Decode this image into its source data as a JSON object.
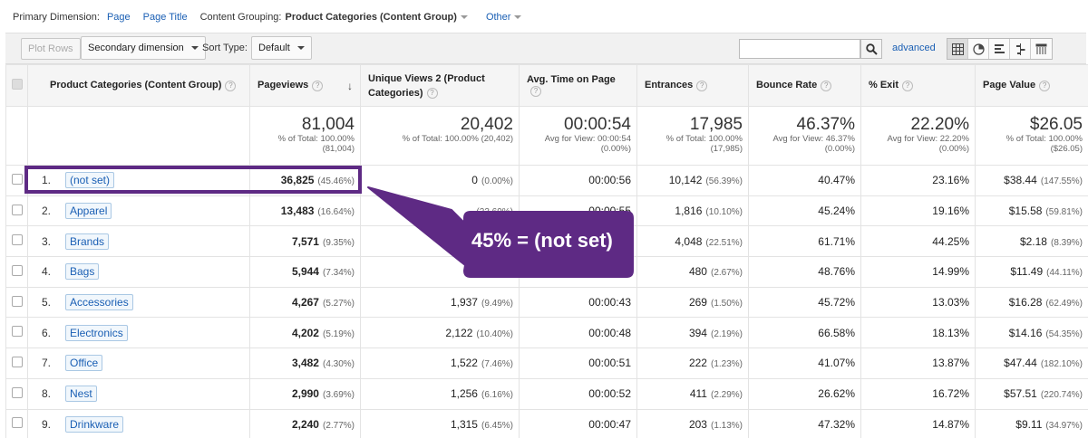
{
  "dimension_bar": {
    "label": "Primary Dimension:",
    "options": [
      "Page",
      "Page Title"
    ],
    "grouping_label": "Content Grouping:",
    "grouping_value": "Product Categories (Content Group)",
    "other": "Other"
  },
  "toolbar": {
    "plot_rows": "Plot Rows",
    "secondary_dimension": "Secondary dimension",
    "sort_type_label": "Sort Type:",
    "sort_type_value": "Default",
    "search_value": "",
    "advanced": "advanced"
  },
  "table": {
    "headers": {
      "dimension": "Product Categories (Content Group)",
      "pageviews": "Pageviews",
      "unique_views": "Unique Views 2 (Product Categories)",
      "avg_time": "Avg. Time on Page",
      "entrances": "Entrances",
      "bounce_rate": "Bounce Rate",
      "exit": "% Exit",
      "page_value": "Page Value"
    },
    "totals": {
      "pageviews": {
        "value": "81,004",
        "sub": "% of Total: 100.00% (81,004)"
      },
      "unique_views": {
        "value": "20,402",
        "sub": "% of Total: 100.00% (20,402)"
      },
      "avg_time": {
        "value": "00:00:54",
        "sub": "Avg for View: 00:00:54 (0.00%)"
      },
      "entrances": {
        "value": "17,985",
        "sub": "% of Total: 100.00% (17,985)"
      },
      "bounce_rate": {
        "value": "46.37%",
        "sub": "Avg for View: 46.37% (0.00%)"
      },
      "exit": {
        "value": "22.20%",
        "sub": "Avg for View: 22.20% (0.00%)"
      },
      "page_value": {
        "value": "$26.05",
        "sub": "% of Total: 100.00% ($26.05)"
      }
    },
    "rows": [
      {
        "num": "1.",
        "dim": "(not set)",
        "pv": "36,825",
        "pv_pct": "(45.46%)",
        "uv": "0",
        "uv_pct": "(0.00%)",
        "time": "00:00:56",
        "ent": "10,142",
        "ent_pct": "(56.39%)",
        "bounce": "40.47%",
        "exit": "23.16%",
        "val": "$38.44",
        "val_pct": "(147.55%)"
      },
      {
        "num": "2.",
        "dim": "Apparel",
        "pv": "13,483",
        "pv_pct": "(16.64%)",
        "uv": "",
        "uv_pct": "(23.69%)",
        "time": "00:00:55",
        "ent": "1,816",
        "ent_pct": "(10.10%)",
        "bounce": "45.24%",
        "exit": "19.16%",
        "val": "$15.58",
        "val_pct": "(59.81%)"
      },
      {
        "num": "3.",
        "dim": "Brands",
        "pv": "7,571",
        "pv_pct": "(9.35%)",
        "uv": "5,",
        "uv_pct": "",
        "time": "",
        "ent": "4,048",
        "ent_pct": "(22.51%)",
        "bounce": "61.71%",
        "exit": "44.25%",
        "val": "$2.18",
        "val_pct": "(8.39%)"
      },
      {
        "num": "4.",
        "dim": "Bags",
        "pv": "5,944",
        "pv_pct": "(7.34%)",
        "uv": "2,3",
        "uv_pct": "",
        "time": "",
        "ent": "480",
        "ent_pct": "(2.67%)",
        "bounce": "48.76%",
        "exit": "14.99%",
        "val": "$11.49",
        "val_pct": "(44.11%)"
      },
      {
        "num": "5.",
        "dim": "Accessories",
        "pv": "4,267",
        "pv_pct": "(5.27%)",
        "uv": "1,937",
        "uv_pct": "(9.49%)",
        "time": "00:00:43",
        "ent": "269",
        "ent_pct": "(1.50%)",
        "bounce": "45.72%",
        "exit": "13.03%",
        "val": "$16.28",
        "val_pct": "(62.49%)"
      },
      {
        "num": "6.",
        "dim": "Electronics",
        "pv": "4,202",
        "pv_pct": "(5.19%)",
        "uv": "2,122",
        "uv_pct": "(10.40%)",
        "time": "00:00:48",
        "ent": "394",
        "ent_pct": "(2.19%)",
        "bounce": "66.58%",
        "exit": "18.13%",
        "val": "$14.16",
        "val_pct": "(54.35%)"
      },
      {
        "num": "7.",
        "dim": "Office",
        "pv": "3,482",
        "pv_pct": "(4.30%)",
        "uv": "1,522",
        "uv_pct": "(7.46%)",
        "time": "00:00:51",
        "ent": "222",
        "ent_pct": "(1.23%)",
        "bounce": "41.07%",
        "exit": "13.87%",
        "val": "$47.44",
        "val_pct": "(182.10%)"
      },
      {
        "num": "8.",
        "dim": "Nest",
        "pv": "2,990",
        "pv_pct": "(3.69%)",
        "uv": "1,256",
        "uv_pct": "(6.16%)",
        "time": "00:00:52",
        "ent": "411",
        "ent_pct": "(2.29%)",
        "bounce": "26.62%",
        "exit": "16.72%",
        "val": "$57.51",
        "val_pct": "(220.74%)"
      },
      {
        "num": "9.",
        "dim": "Drinkware",
        "pv": "2,240",
        "pv_pct": "(2.77%)",
        "uv": "1,315",
        "uv_pct": "(6.45%)",
        "time": "00:00:47",
        "ent": "203",
        "ent_pct": "(1.13%)",
        "bounce": "47.32%",
        "exit": "14.87%",
        "val": "$9.11",
        "val_pct": "(34.97%)"
      }
    ]
  },
  "annotation": {
    "callout_text": "45% = (not set)",
    "color": "#5e2a84"
  }
}
